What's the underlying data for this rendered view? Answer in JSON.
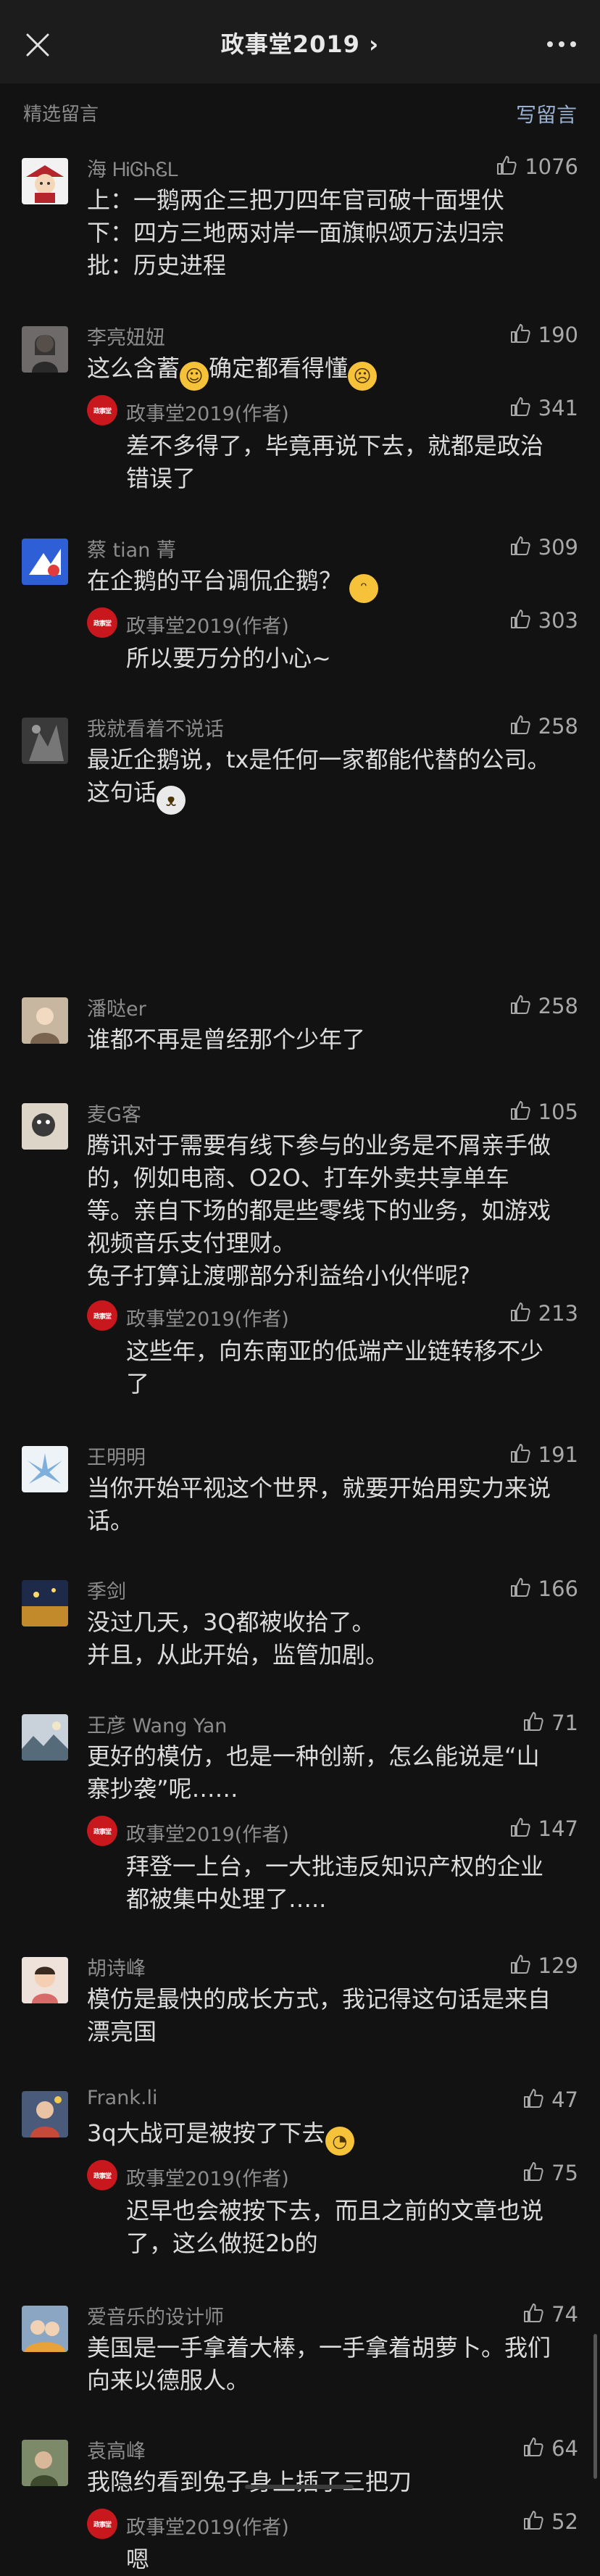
{
  "header": {
    "title": "政事堂2019 ›"
  },
  "section": {
    "label": "精选留言",
    "write_label": "写留言"
  },
  "comments": [
    {
      "name": "海 ᎻᎥᎶᏂᏋᏞ",
      "likes": "1076",
      "text": "上：一鹅两企三把刀四年官司破十面埋伏\n下：四方三地两对岸一面旗帜颂万法归宗\n批：历史进程"
    },
    {
      "name": "李亮妞妞",
      "likes": "190",
      "text_a": "这么含蓄",
      "text_b": "确定都看得懂",
      "reply": {
        "name": "政事堂2019(作者)",
        "likes": "341",
        "text": "差不多得了，毕竟再说下去，就都是政治\n错误了"
      }
    },
    {
      "name": "蔡 tian 菁",
      "likes": "309",
      "text": "在企鹅的平台调侃企鹅？",
      "reply": {
        "name": "政事堂2019(作者)",
        "likes": "303",
        "text": "所以要万分的小心~"
      }
    },
    {
      "name": "我就看着不说话",
      "likes": "258",
      "text": "最近企鹅说，tx是任何一家都能代替的公司。\n这句话"
    },
    {
      "name": "潘哒er",
      "likes": "258",
      "text": "谁都不再是曾经那个少年了"
    },
    {
      "name": "麦G客",
      "likes": "105",
      "text": "腾讯对于需要有线下参与的业务是不屑亲手做\n的，例如电商、O2O、打车外卖共享单车\n等。亲自下场的都是些零线下的业务，如游戏\n视频音乐支付理财。\n兔子打算让渡哪部分利益给小伙伴呢?",
      "reply": {
        "name": "政事堂2019(作者)",
        "likes": "213",
        "text": "这些年，向东南亚的低端产业链转移不少\n了"
      }
    },
    {
      "name": "王明明",
      "likes": "191",
      "text": "当你开始平视这个世界，就要开始用实力来说\n话。"
    },
    {
      "name": "季剑",
      "likes": "166",
      "text": "没过几天，3Q都被收拾了。\n并且，从此开始，监管加剧。"
    },
    {
      "name": "王彦 Wang Yan",
      "likes": "71",
      "text": "更好的模仿，也是一种创新，怎么能说是“山\n寨抄袭”呢……",
      "reply": {
        "name": "政事堂2019(作者)",
        "likes": "147",
        "text": "拜登一上台，一大批违反知识产权的企业\n都被集中处理了….."
      }
    },
    {
      "name": "胡诗峰",
      "likes": "129",
      "text": "模仿是最快的成长方式，我记得这句话是来自\n漂亮国"
    },
    {
      "name": "Frank.li",
      "likes": "47",
      "text": "3q大战可是被按了下去",
      "reply": {
        "name": "政事堂2019(作者)",
        "likes": "75",
        "text": "迟早也会被按下去，而且之前的文章也说\n了，这么做挺2b的"
      }
    },
    {
      "name": "爱音乐的设计师",
      "likes": "74",
      "text": "美国是一手拿着大棒，一手拿着胡萝卜。我们\n向来以德服人。"
    },
    {
      "name": "袁高峰",
      "likes": "64",
      "text": "我隐约看到兔子身上插了三把刀",
      "reply": {
        "name": "政事堂2019(作者)",
        "likes": "52",
        "text": "嗯"
      }
    }
  ],
  "author_badge": "政事堂",
  "colors": {
    "background": "#121212",
    "header": "#1c1c1c",
    "author_avatar": "#c8171d",
    "link": "#9ab0d0"
  }
}
